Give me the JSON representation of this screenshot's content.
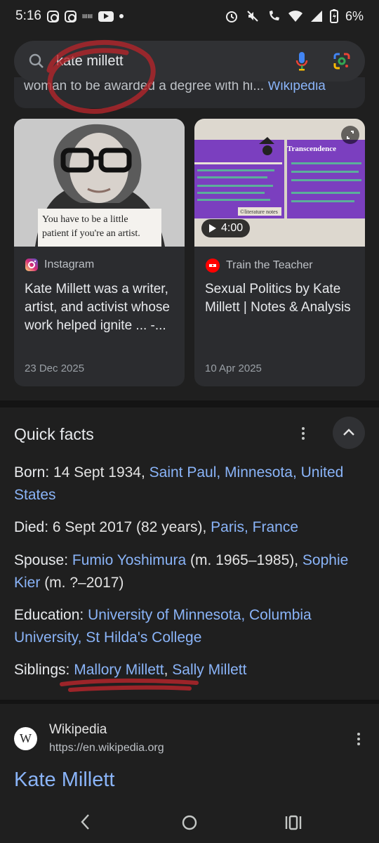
{
  "status_bar": {
    "time": "5:16",
    "battery": "6%",
    "icons": [
      "instagram-icon",
      "instagram-icon",
      "news-icon",
      "youtube-icon",
      "dot-icon",
      "alarm-icon",
      "mute-icon",
      "wifi-call-icon",
      "wifi-icon",
      "signal-icon",
      "battery-icon"
    ]
  },
  "search": {
    "query": "kate millett",
    "icons": [
      "search-icon",
      "mic-icon",
      "google-lens-icon"
    ]
  },
  "partial_result": {
    "text": "woman to be awarded a degree with hi...",
    "link": "Wikipedia"
  },
  "cards": [
    {
      "source": "Instagram",
      "title": "Kate Millett was a writer, artist, and activist whose work helped ignite ... -...",
      "date": "23 Dec 2025",
      "quote": "You have to be a little patient if you're an artist."
    },
    {
      "source": "Train the Teacher",
      "title": "Sexual Politics by Kate Millett | Notes & Analysis",
      "date": "10 Apr 2025",
      "duration": "4:00",
      "thumb_heading": "Transcendence",
      "thumb_credit": "©literature notes"
    }
  ],
  "quick_facts": {
    "title": "Quick facts",
    "born": {
      "label": "Born:",
      "text": " 14 Sept 1934, ",
      "link": "Saint Paul, Minnesota, United States"
    },
    "died": {
      "label": "Died:",
      "text": " 6 Sept 2017 (82 years), ",
      "link": "Paris, France"
    },
    "spouse": {
      "label": "Spouse:",
      "link1": "Fumio Yoshimura",
      "text1": " (m. 1965–1985), ",
      "link2": "Sophie Kier",
      "text2": " (m. ?–2017)"
    },
    "education": {
      "label": "Education:",
      "link": "University of Minnesota, Columbia University, St Hilda's College"
    },
    "siblings": {
      "label": "Siblings:",
      "link1": "Mallory Millett",
      "sep": ", ",
      "link2": "Sally Millett"
    }
  },
  "wikipedia_result": {
    "site": "Wikipedia",
    "url": "https://en.wikipedia.org",
    "title": "Kate Millett",
    "logo_letter": "W"
  },
  "colors": {
    "background": "#1f1f1f",
    "link": "#8ab4f8",
    "annotation": "#b3262b"
  }
}
